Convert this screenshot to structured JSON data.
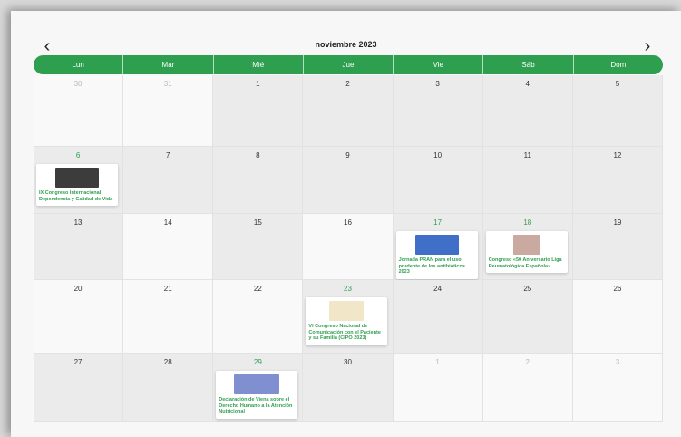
{
  "calendar": {
    "month_title": "noviembre 2023",
    "prev_label": "‹",
    "next_label": "›",
    "weekdays": [
      "Lun",
      "Mar",
      "Mié",
      "Jue",
      "Vie",
      "Sáb",
      "Dom"
    ],
    "weeks": [
      [
        "30",
        "31",
        "1",
        "2",
        "3",
        "4",
        "5"
      ],
      [
        "6",
        "7",
        "8",
        "9",
        "10",
        "11",
        "12"
      ],
      [
        "13",
        "14",
        "15",
        "16",
        "17",
        "18",
        "19"
      ],
      [
        "20",
        "21",
        "22",
        "23",
        "24",
        "25",
        "26"
      ],
      [
        "27",
        "28",
        "29",
        "30",
        "1",
        "2",
        "3"
      ]
    ],
    "events": [
      {
        "title": "IX Congreso Internacional Dependencia y Calidad de Vida",
        "thumb_color": "#3c3c3c"
      },
      {
        "title": "Jornada PRAN para el uso prudente de los antibióticos 2023",
        "thumb_color": "#3f6fc6"
      },
      {
        "title": "Congreso «50 Aniversario Liga Reumatológica Española»",
        "thumb_color": "#c9a9a0"
      },
      {
        "title": "VI Congreso Nacional de Comunicación con el Paciente y su Familia (CIPO 2023)",
        "thumb_color": "#f1e6c8"
      },
      {
        "title": "Declaración de Viena sobre el Derecho Humano a la Atención Nutricional",
        "thumb_color": "#7f8fd0"
      }
    ],
    "accent_color": "#2e9e4f"
  }
}
